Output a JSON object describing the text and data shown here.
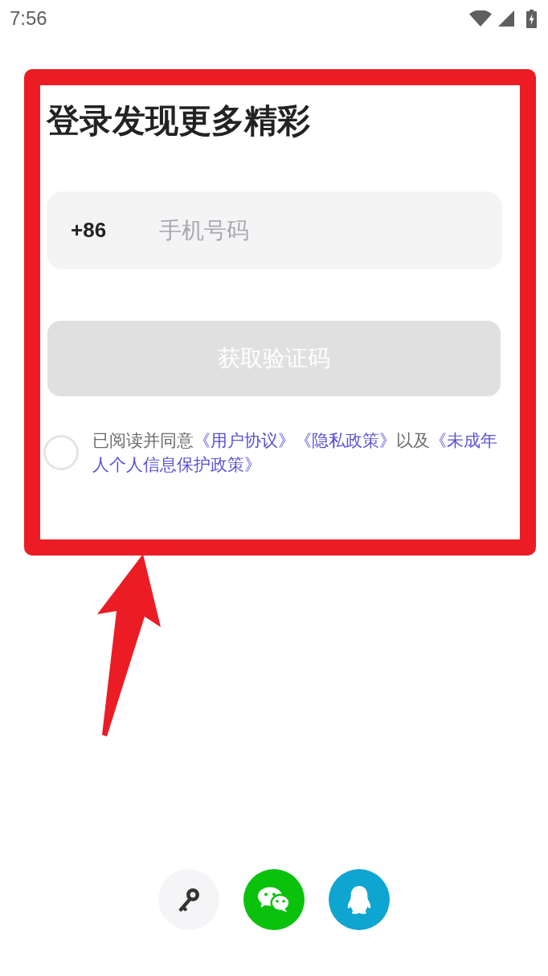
{
  "status_bar": {
    "time": "7:56"
  },
  "title": "登录发现更多精彩",
  "phone": {
    "country_code": "+86",
    "placeholder": "手机号码"
  },
  "code_button": {
    "label": "获取验证码",
    "disabled": true
  },
  "agreement": {
    "checked": false,
    "parts": [
      {
        "kind": "text",
        "text": "已阅读并同意"
      },
      {
        "kind": "link",
        "text": "《用户协议》"
      },
      {
        "kind": "link",
        "text": "《隐私政策》"
      },
      {
        "kind": "text",
        "text": "以及"
      },
      {
        "kind": "link",
        "text": "《未成年"
      },
      {
        "kind": "link",
        "text": "人个人信息保护政策》"
      }
    ]
  },
  "social_logins": [
    {
      "kind": "key"
    },
    {
      "kind": "wechat"
    },
    {
      "kind": "qq"
    }
  ],
  "annotation": {
    "kind": "frame-and-arrow"
  }
}
